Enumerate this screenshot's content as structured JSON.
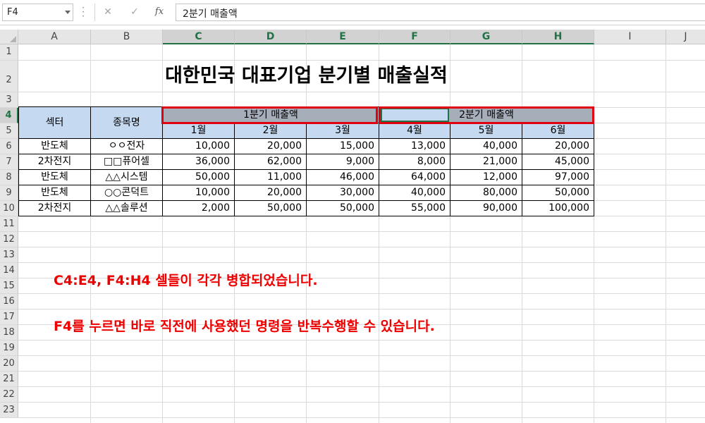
{
  "formula_bar": {
    "name_box": "F4",
    "cancel_icon": "✕",
    "enter_icon": "✓",
    "fx_label": "fx",
    "content": "2분기 매출액"
  },
  "columns": [
    "A",
    "B",
    "C",
    "D",
    "E",
    "F",
    "G",
    "H",
    "I",
    "J"
  ],
  "rows": [
    "1",
    "2",
    "3",
    "4",
    "5",
    "6",
    "7",
    "8",
    "9",
    "10",
    "11",
    "12",
    "13",
    "14",
    "15",
    "16",
    "17",
    "18",
    "19",
    "20",
    "21",
    "22",
    "23"
  ],
  "sheet": {
    "title": "대한민국 대표기업 분기별 매출실적",
    "headers": {
      "sector": "섹터",
      "stock_name": "종목명",
      "q1": "1분기 매출액",
      "q2": "2분기 매출액",
      "months": [
        "1월",
        "2월",
        "3월",
        "4월",
        "5월",
        "6월"
      ]
    },
    "data_rows": [
      {
        "sector": "반도체",
        "name": "ㅇㅇ전자",
        "values": [
          "10,000",
          "20,000",
          "15,000",
          "13,000",
          "40,000",
          "20,000"
        ]
      },
      {
        "sector": "2차전지",
        "name": "□□퓨어셀",
        "values": [
          "36,000",
          "62,000",
          "9,000",
          "8,000",
          "21,000",
          "45,000"
        ]
      },
      {
        "sector": "반도체",
        "name": "△△시스템",
        "values": [
          "50,000",
          "11,000",
          "46,000",
          "64,000",
          "12,000",
          "97,000"
        ]
      },
      {
        "sector": "반도체",
        "name": "○○콘덕트",
        "values": [
          "10,000",
          "20,000",
          "30,000",
          "40,000",
          "80,000",
          "50,000"
        ]
      },
      {
        "sector": "2차전지",
        "name": "△△솔루션",
        "values": [
          "2,000",
          "50,000",
          "50,000",
          "55,000",
          "90,000",
          "100,000"
        ]
      }
    ]
  },
  "notes": [
    "C4:E4, F4:H4 셀들이 각각 병합되었습니다.",
    "F4를 누르면 바로 직전에 사용했던 명령을 반복수행할 수 있습니다."
  ],
  "colors": {
    "accent_green": "#217346",
    "header_blue": "#c5d9f1",
    "header_gray": "#a6aeba",
    "annotation_red": "#ee0000"
  }
}
